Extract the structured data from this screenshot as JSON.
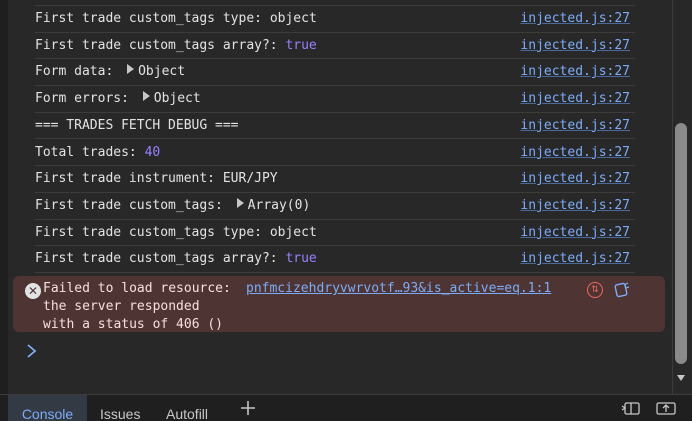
{
  "console": {
    "rows": [
      {
        "prefix": "First trade custom_tags type: ",
        "value": "object",
        "value_kind": "plain",
        "expandable": false,
        "source": "injected.js:27"
      },
      {
        "prefix": "First trade custom_tags array?: ",
        "value": "true",
        "value_kind": "bool",
        "expandable": false,
        "source": "injected.js:27"
      },
      {
        "prefix": "Form data: ",
        "value": "Object",
        "value_kind": "object",
        "expandable": true,
        "source": "injected.js:27"
      },
      {
        "prefix": "Form errors: ",
        "value": "Object",
        "value_kind": "object",
        "expandable": true,
        "source": "injected.js:27"
      },
      {
        "prefix": "=== TRADES FETCH DEBUG ===",
        "value": "",
        "value_kind": "plain",
        "expandable": false,
        "source": "injected.js:27"
      },
      {
        "prefix": "Total trades: ",
        "value": "40",
        "value_kind": "number",
        "expandable": false,
        "source": "injected.js:27"
      },
      {
        "prefix": "First trade instrument: ",
        "value": "EUR/JPY",
        "value_kind": "plain",
        "expandable": false,
        "source": "injected.js:27"
      },
      {
        "prefix": "First trade custom_tags: ",
        "value": "Array(0)",
        "value_kind": "object",
        "expandable": true,
        "source": "injected.js:27"
      },
      {
        "prefix": "First trade custom_tags type: ",
        "value": "object",
        "value_kind": "plain",
        "expandable": false,
        "source": "injected.js:27"
      },
      {
        "prefix": "First trade custom_tags array?: ",
        "value": "true",
        "value_kind": "bool",
        "expandable": false,
        "source": "injected.js:27"
      }
    ],
    "error": {
      "line1": "Failed to load resource:",
      "line2": "the server responded",
      "line3": "with a status of 406 ()",
      "link": "pnfmcizehdryvwrvotf…93&is_active=eq.1:1",
      "icon": "close-icon"
    },
    "prompt_icon": "chevron-right-icon"
  },
  "bottom_tabs": [
    {
      "label": "Console",
      "active": true
    },
    {
      "label": "Issues",
      "active": false
    },
    {
      "label": "Autofill",
      "active": false
    }
  ],
  "colors": {
    "background": "#282828",
    "link": "#7cacf8",
    "boolean": "#9980ff",
    "error_bg": "#4e3534"
  }
}
